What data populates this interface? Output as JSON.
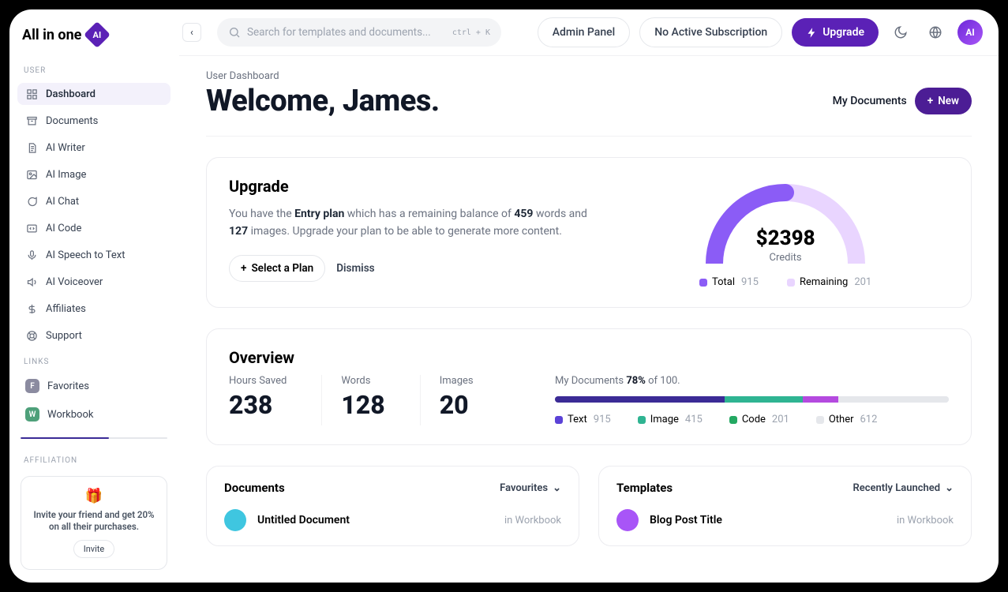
{
  "brand": {
    "text_prefix": "All in one",
    "badge": "AI"
  },
  "sidebar": {
    "section_user": "USER",
    "items": [
      {
        "label": "Dashboard"
      },
      {
        "label": "Documents"
      },
      {
        "label": "AI Writer"
      },
      {
        "label": "AI Image"
      },
      {
        "label": "AI Chat"
      },
      {
        "label": "AI Code"
      },
      {
        "label": "AI Speech to Text"
      },
      {
        "label": "AI Voiceover"
      },
      {
        "label": "Affiliates"
      },
      {
        "label": "Support"
      }
    ],
    "section_links": "LINKS",
    "links": [
      {
        "label": "Favorites",
        "badge": "F",
        "badge_color": "#8b8ba0"
      },
      {
        "label": "Workbook",
        "badge": "W",
        "badge_color": "#4ea07a"
      }
    ],
    "section_aff": "AFFILIATION",
    "aff_message": "Invite your friend and get 20% on all their purchases.",
    "aff_button": "Invite"
  },
  "topbar": {
    "search_placeholder": "Search for templates and documents...",
    "shortcut": "ctrl + K",
    "admin_panel": "Admin Panel",
    "subscription": "No Active Subscription",
    "upgrade": "Upgrade",
    "avatar": "AI"
  },
  "page": {
    "crumb": "User Dashboard",
    "welcome": "Welcome, James.",
    "my_documents": "My Documents",
    "new": "New"
  },
  "upgrade_card": {
    "title": "Upgrade",
    "text_pre": "You have the ",
    "plan": "Entry plan",
    "text_mid1": " which has a remaining balance of ",
    "words": "459",
    "text_mid2": " words and ",
    "images": "127",
    "text_post": " images. Upgrade your plan to be able to generate more content.",
    "select_plan": "Select a Plan",
    "dismiss": "Dismiss",
    "credits_value": "$2398",
    "credits_label": "Credits",
    "legend_total": "Total",
    "legend_total_val": "915",
    "legend_remaining": "Remaining",
    "legend_remaining_val": "201"
  },
  "overview": {
    "title": "Overview",
    "stats": [
      {
        "label": "Hours Saved",
        "value": "238"
      },
      {
        "label": "Words",
        "value": "128"
      },
      {
        "label": "Images",
        "value": "20"
      }
    ],
    "caption_pre": "My Documents ",
    "caption_pct": "78%",
    "caption_post": " of 100.",
    "segments": [
      {
        "label": "Text",
        "value": "915",
        "color": "#3b2b96",
        "pct": 43
      },
      {
        "label": "Image",
        "value": "415",
        "color": "#2fb492",
        "pct": 20
      },
      {
        "label": "Code",
        "value": "201",
        "color": "#b44adf",
        "pct": 9
      },
      {
        "label": "Other",
        "value": "612",
        "color": "#e5e7eb",
        "pct": 28
      }
    ]
  },
  "documents_panel": {
    "title": "Documents",
    "filter": "Favourites",
    "row_title": "Untitled Document",
    "row_meta": "in Workbook",
    "row_color": "#3fc6e0"
  },
  "templates_panel": {
    "title": "Templates",
    "filter": "Recently Launched",
    "row_title": "Blog Post Title",
    "row_meta": "in Workbook",
    "row_color": "#a855f7"
  },
  "chart_data": {
    "type": "gauge",
    "title": "Credits",
    "value_label": "$2398",
    "series": [
      {
        "name": "Total",
        "value": 915,
        "color": "#8b5cf6"
      },
      {
        "name": "Remaining",
        "value": 201,
        "color": "#e9d5ff"
      }
    ],
    "fill_pct_of_arc": 50
  }
}
